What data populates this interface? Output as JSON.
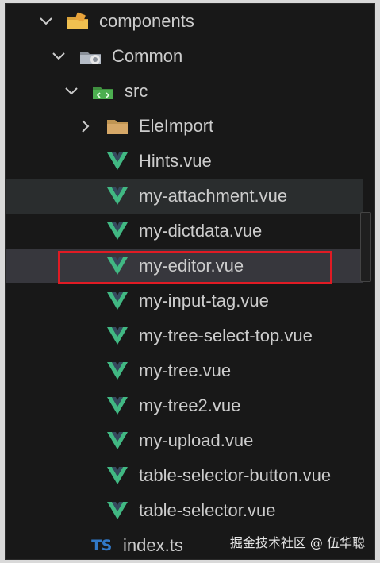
{
  "tree": {
    "components": "components",
    "common": "Common",
    "src": "src",
    "eleimport": "EleImport",
    "files": [
      "Hints.vue",
      "my-attachment.vue",
      "my-dictdata.vue",
      "my-editor.vue",
      "my-input-tag.vue",
      "my-tree-select-top.vue",
      "my-tree.vue",
      "my-tree2.vue",
      "my-upload.vue",
      "table-selector-button.vue",
      "table-selector.vue"
    ],
    "index_file": "index.ts",
    "ts_badge": "TS"
  },
  "watermark": "掘金技术社区 @ 伍华聪",
  "icons": {
    "chevron_expanded": "chevron-down-icon",
    "chevron_collapsed": "chevron-right-icon",
    "vue": "vue-file-icon",
    "ts": "typescript-file-icon",
    "folder": "folder-icon"
  },
  "colors": {
    "background": "#181818",
    "text": "#cccccc",
    "vue_green": "#41b883",
    "vue_dark": "#35495e",
    "ts_blue": "#3178c6",
    "highlight_red": "#e01b24"
  }
}
